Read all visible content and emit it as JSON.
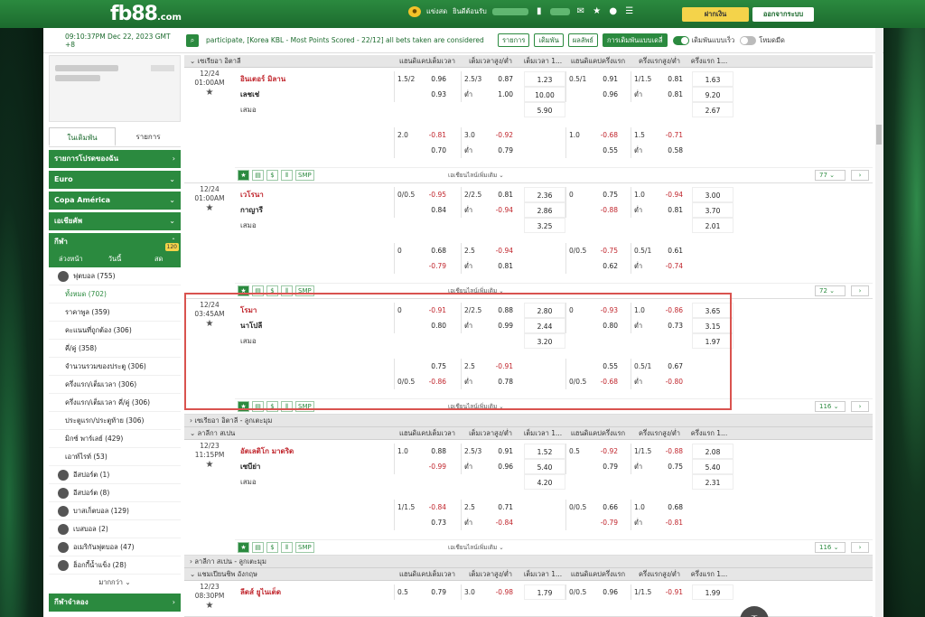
{
  "brand": {
    "logo": "fb88",
    "logo_suffix": ".com"
  },
  "top": {
    "promo": "แข่งสด",
    "user_label": "ยินดีต้อนรับ",
    "deposit": "ฝากเงิน",
    "logout": "ออกจากระบบ"
  },
  "info": {
    "clock": "09:10:37PM Dec 22, 2023 GMT +8",
    "ticker": "participate, [Korea KBL - Most Points Scored - 22/12] all bets taken are considered",
    "btn_list": "รายการ",
    "btn_bets": "เดิมพัน",
    "btn_results": "ผลลัพธ์",
    "btn_odds": "การเดิมพันแบบเดลี่",
    "toggle1": "เดิมพันแบบเร็ว",
    "toggle2": "โหมดมืด"
  },
  "sidebar": {
    "tab_bet": "ในเดิมพัน",
    "tab_list": "รายการ",
    "fav": "รายการโปรดของฉัน",
    "euro": "Euro",
    "copa": "Copa América",
    "asia": "เอเชียคัพ",
    "sports": "กีฬา",
    "sub_early": "ล่วงหน้า",
    "sub_today": "วันนี้",
    "sub_live": "สด",
    "live_badge": "120",
    "football": "ฟุตบอล (755)",
    "sub": [
      "ทั้งหมด (702)",
      "ราคาพูล (359)",
      "คะแนนที่ถูกต้อง (306)",
      "คี่/คู่ (358)",
      "จำนวนรวมของประตู (306)",
      "ครึ่งแรก/เต็มเวลา (306)",
      "ครึ่งแรก/เต็มเวลา คี่/คู่ (306)",
      "ประตูแรก/ประตูท้าย (306)",
      "มิกซ์ พาร์เลย์ (429)",
      "เอาท์ไรท์ (53)"
    ],
    "others": [
      "อีสปอร์ต (1)",
      "อีสปอร์ต (8)",
      "บาสเก็ตบอล (129)",
      "เบสบอล (2)",
      "อเมริกันฟุตบอล (47)",
      "ฮ็อกกี้น้ำแข็ง (28)"
    ],
    "more": "มากกว่า",
    "virtual": "กีฬาจำลอง"
  },
  "cols": [
    "แฮนดิแคปเต็มเวลา",
    "เต็มเวลาสูง/ต่ำ",
    "เต็มเวลา 1...",
    "แฮนดิแคปครึ่งแรก",
    "ครึ่งแรกสูง/ต่ำ",
    "ครึ่งแรก 1..."
  ],
  "leagues": {
    "l1": "เซเรียอา อิตาลี",
    "l2": "ลาลีกา สเปน",
    "l3": "เซเรียอา อิตาลี - ลูกเตะมุม",
    "l4": "ลาลีกา สเปน - ลูกเตะมุม",
    "l5": "แชมเปียนชิพ อังกฤษ"
  },
  "more_lines": "เอเชียนไลน์เพิ่มเติม",
  "smp": "SMP",
  "m1": {
    "date": "12/24",
    "time": "01:00AM",
    "home": "อินเตอร์ มิลาน",
    "away": "เลชเช่",
    "draw": "เสมอ",
    "count": "77",
    "r1": [
      [
        "1.5/2",
        "0.96"
      ],
      [
        "2.5/3",
        "0.87"
      ],
      "1.23",
      [
        "0.5/1",
        "0.91"
      ],
      [
        "1/1.5",
        "0.81"
      ],
      "1.63"
    ],
    "r2": [
      [
        "",
        "0.93"
      ],
      [
        "ต่ำ",
        "1.00"
      ],
      "10.00",
      [
        "",
        "0.96"
      ],
      [
        "ต่ำ",
        "0.81"
      ],
      "9.20"
    ],
    "r3": "5.90",
    "r3b": "2.67",
    "r4": [
      [
        "2.0",
        "-0.81"
      ],
      [
        "3.0",
        "-0.92"
      ],
      [
        "1.0",
        "-0.68"
      ],
      [
        "1.5",
        "-0.71"
      ]
    ],
    "r5": [
      [
        "",
        "0.70"
      ],
      [
        "ต่ำ",
        "0.79"
      ],
      [
        "",
        "0.55"
      ],
      [
        "ต่ำ",
        "0.58"
      ]
    ]
  },
  "m2": {
    "date": "12/24",
    "time": "01:00AM",
    "home": "เวโรนา",
    "away": "กาญารี",
    "draw": "เสมอ",
    "count": "72",
    "r1": [
      [
        "0/0.5",
        "-0.95"
      ],
      [
        "2/2.5",
        "0.81"
      ],
      "2.36",
      [
        "0",
        "0.75"
      ],
      [
        "1.0",
        "-0.94"
      ],
      "3.00"
    ],
    "r2": [
      [
        "",
        "0.84"
      ],
      [
        "ต่ำ",
        "-0.94"
      ],
      "2.86",
      [
        "",
        "-0.88"
      ],
      [
        "ต่ำ",
        "0.81"
      ],
      "3.70"
    ],
    "r3": "3.25",
    "r3b": "2.01",
    "r4": [
      [
        "0",
        "0.68"
      ],
      [
        "2.5",
        "-0.94"
      ],
      [
        "0/0.5",
        "-0.75"
      ],
      [
        "0.5/1",
        "0.61"
      ]
    ],
    "r5": [
      [
        "",
        "-0.79"
      ],
      [
        "ต่ำ",
        "0.81"
      ],
      [
        "",
        "0.62"
      ],
      [
        "ต่ำ",
        "-0.74"
      ]
    ]
  },
  "m3": {
    "date": "12/24",
    "time": "03:45AM",
    "home": "โรมา",
    "away": "นาโปลี",
    "draw": "เสมอ",
    "count": "116",
    "r1": [
      [
        "0",
        "-0.91"
      ],
      [
        "2/2.5",
        "0.88"
      ],
      "2.80",
      [
        "0",
        "-0.93"
      ],
      [
        "1.0",
        "-0.86"
      ],
      "3.65"
    ],
    "r2": [
      [
        "",
        "0.80"
      ],
      [
        "ต่ำ",
        "0.99"
      ],
      "2.44",
      [
        "",
        "0.80"
      ],
      [
        "ต่ำ",
        "0.73"
      ],
      "3.15"
    ],
    "r3": "3.20",
    "r3b": "1.97",
    "r4": [
      [
        "",
        "0.75"
      ],
      [
        "2.5",
        "-0.91"
      ],
      [
        "",
        "0.55"
      ],
      [
        "0.5/1",
        "0.67"
      ]
    ],
    "r5": [
      [
        "0/0.5",
        "-0.86"
      ],
      [
        "ต่ำ",
        "0.78"
      ],
      [
        "0/0.5",
        "-0.68"
      ],
      [
        "ต่ำ",
        "-0.80"
      ]
    ]
  },
  "m4": {
    "date": "12/23",
    "time": "11:15PM",
    "home": "อัตเลติโก มาดริด",
    "away": "เซบีย่า",
    "draw": "เสมอ",
    "count": "116",
    "r1": [
      [
        "1.0",
        "0.88"
      ],
      [
        "2.5/3",
        "0.91"
      ],
      "1.52",
      [
        "0.5",
        "-0.92"
      ],
      [
        "1/1.5",
        "-0.88"
      ],
      "2.08"
    ],
    "r2": [
      [
        "",
        "-0.99"
      ],
      [
        "ต่ำ",
        "0.96"
      ],
      "5.40",
      [
        "",
        "0.79"
      ],
      [
        "ต่ำ",
        "0.75"
      ],
      "5.40"
    ],
    "r3": "4.20",
    "r3b": "2.31",
    "r4": [
      [
        "1/1.5",
        "-0.84"
      ],
      [
        "2.5",
        "0.71"
      ],
      [
        "0/0.5",
        "0.66"
      ],
      [
        "1.0",
        "0.68"
      ]
    ],
    "r5": [
      [
        "",
        "0.73"
      ],
      [
        "ต่ำ",
        "-0.84"
      ],
      [
        "",
        "-0.79"
      ],
      [
        "ต่ำ",
        "-0.81"
      ]
    ]
  },
  "m5": {
    "date": "12/23",
    "time": "08:30PM",
    "home": "ลีดส์ ยูไนเต็ด",
    "r1": [
      [
        "0.5",
        "0.79"
      ],
      [
        "3.0",
        "-0.98"
      ],
      "1.79",
      [
        "0/0.5",
        "0.96"
      ],
      [
        "1/1.5",
        "-0.91"
      ],
      "1.99"
    ]
  }
}
